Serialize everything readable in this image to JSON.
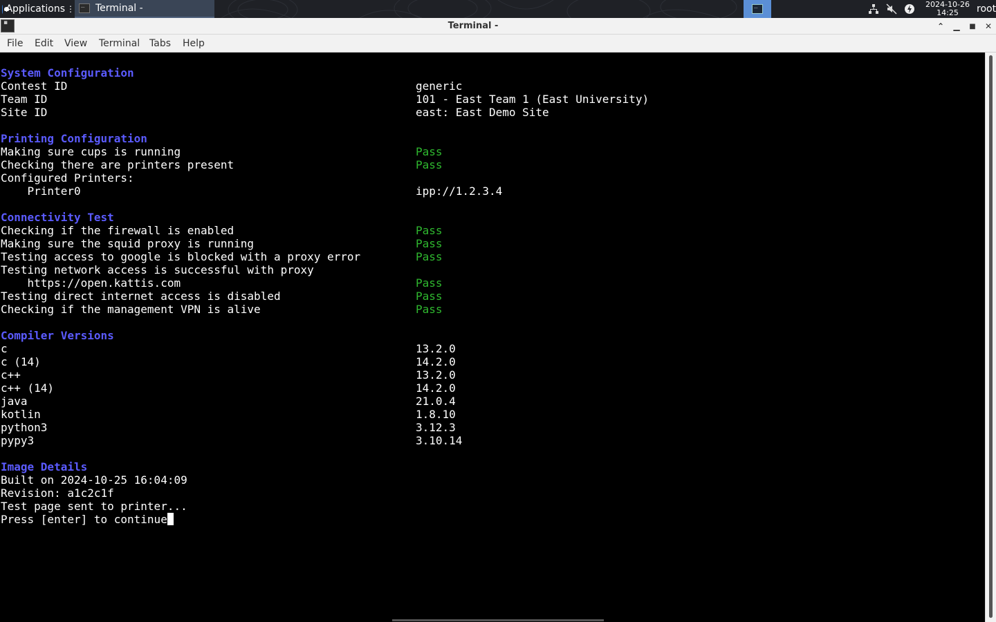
{
  "panel": {
    "applications_label": "Applications",
    "task_label": "Terminal -",
    "clock_date": "2024-10-26",
    "clock_time": "14:25",
    "user": "root",
    "icons": [
      "applications-icon",
      "terminal-icon",
      "workspace-terminal-icon",
      "network-icon",
      "volume-muted-icon",
      "power-icon"
    ]
  },
  "window": {
    "title": "Terminal -",
    "buttons": [
      "shade",
      "minimize",
      "maximize",
      "close"
    ]
  },
  "menu": [
    "File",
    "Edit",
    "View",
    "Terminal",
    "Tabs",
    "Help"
  ],
  "colors": {
    "header": "#5b5bff",
    "pass": "#2fb82f",
    "background": "#000000",
    "text": "#ffffff"
  },
  "terminal": {
    "system": {
      "header": "System Configuration",
      "rows": [
        {
          "label": "Contest ID",
          "value": "generic"
        },
        {
          "label": "Team ID",
          "value": "101 - East Team 1 (East University)"
        },
        {
          "label": "Site ID",
          "value": "east: East Demo Site"
        }
      ]
    },
    "printing": {
      "header": "Printing Configuration",
      "rows": [
        {
          "label": "Making sure cups is running",
          "value": "Pass"
        },
        {
          "label": "Checking there are printers present",
          "value": "Pass"
        },
        {
          "label": "Configured Printers:",
          "value": ""
        },
        {
          "label": "    Printer0",
          "value": "ipp://1.2.3.4"
        }
      ]
    },
    "connectivity": {
      "header": "Connectivity Test",
      "rows": [
        {
          "label": "Checking if the firewall is enabled",
          "value": "Pass"
        },
        {
          "label": "Making sure the squid proxy is running",
          "value": "Pass"
        },
        {
          "label": "Testing access to google is blocked with a proxy error",
          "value": "Pass"
        },
        {
          "label": "Testing network access is successful with proxy",
          "value": ""
        },
        {
          "label": "    https://open.kattis.com",
          "value": "Pass"
        },
        {
          "label": "Testing direct internet access is disabled",
          "value": "Pass"
        },
        {
          "label": "Checking if the management VPN is alive",
          "value": "Pass"
        }
      ]
    },
    "compilers": {
      "header": "Compiler Versions",
      "rows": [
        {
          "label": "c",
          "value": "13.2.0"
        },
        {
          "label": "c (14)",
          "value": "14.2.0"
        },
        {
          "label": "c++",
          "value": "13.2.0"
        },
        {
          "label": "c++ (14)",
          "value": "14.2.0"
        },
        {
          "label": "java",
          "value": "21.0.4"
        },
        {
          "label": "kotlin",
          "value": "1.8.10"
        },
        {
          "label": "python3",
          "value": "3.12.3"
        },
        {
          "label": "pypy3",
          "value": "3.10.14"
        }
      ]
    },
    "image": {
      "header": "Image Details",
      "lines": [
        "Built on 2024-10-25 16:04:09",
        "Revision: a1c2c1f",
        "Test page sent to printer..."
      ],
      "prompt": "Press [enter] to continue"
    }
  }
}
